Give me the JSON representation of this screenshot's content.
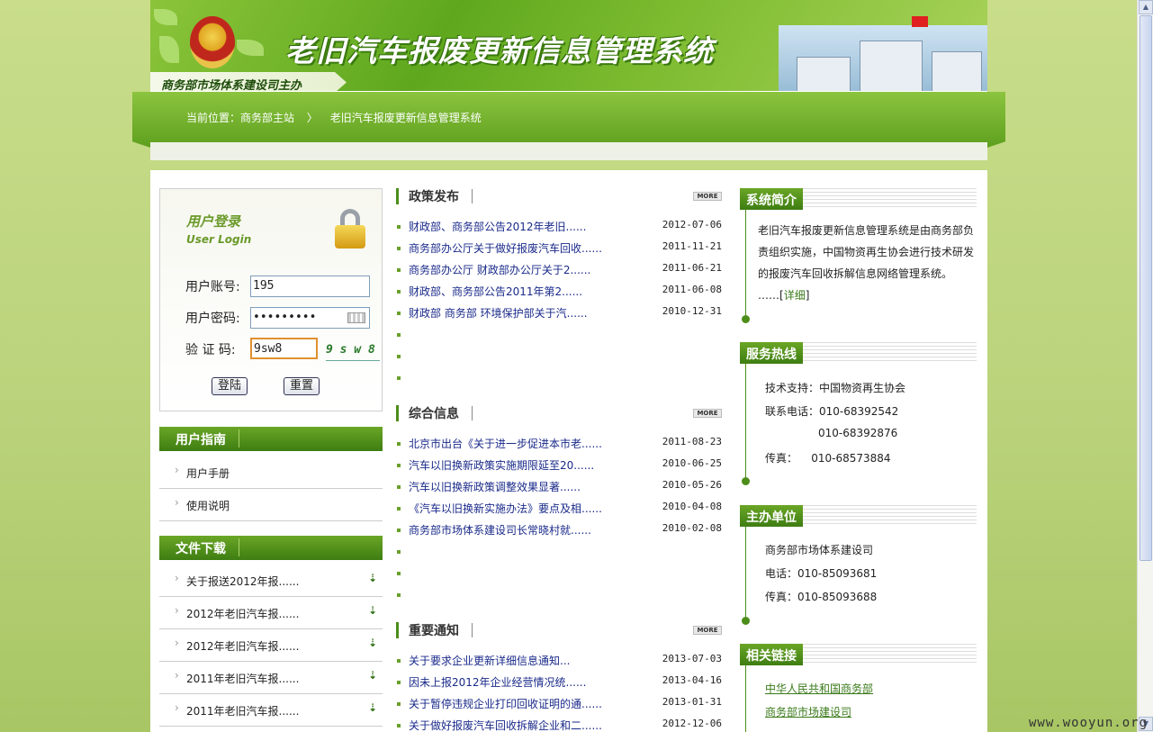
{
  "banner": {
    "title": "老旧汽车报废更新信息管理系统",
    "org": "商务部市场体系建设司主办"
  },
  "breadcrumb": {
    "label": "当前位置：商务部主站",
    "separator": "〉",
    "current": "老旧汽车报废更新信息管理系统"
  },
  "login": {
    "title_cn": "用户登录",
    "title_en": "User Login",
    "account_label": "用户账号:",
    "account_value": "195",
    "password_label": "用户密码:",
    "password_value": "•••••••••",
    "captcha_label": "验 证 码:",
    "captcha_value": "9sw8",
    "captcha_image": "9 s w 8",
    "login_button": "登陆",
    "reset_button": "重置"
  },
  "guide": {
    "title": "用户指南",
    "items": [
      "用户手册",
      "使用说明"
    ]
  },
  "downloads": {
    "title": "文件下载",
    "items": [
      "关于报送2012年报......",
      "2012年老旧汽车报......",
      "2012年老旧汽车报......",
      "2011年老旧汽车报......",
      "2011年老旧汽车报......"
    ]
  },
  "more_label": "MORE",
  "policy": {
    "title": "政策发布",
    "rows": [
      {
        "title": "财政部、商务部公告2012年老旧......",
        "date": "2012-07-06"
      },
      {
        "title": "商务部办公厅关于做好报废汽车回收......",
        "date": "2011-11-21"
      },
      {
        "title": "商务部办公厅 财政部办公厅关于2......",
        "date": "2011-06-21"
      },
      {
        "title": "财政部、商务部公告2011年第2......",
        "date": "2011-06-08"
      },
      {
        "title": "财政部 商务部 环境保护部关于汽......",
        "date": "2010-12-31"
      }
    ]
  },
  "general": {
    "title": "综合信息",
    "rows": [
      {
        "title": "北京市出台《关于进一步促进本市老......",
        "date": "2011-08-23"
      },
      {
        "title": "汽车以旧换新政策实施期限延至20......",
        "date": "2010-06-25"
      },
      {
        "title": "汽车以旧换新政策调整效果显著......",
        "date": "2010-05-26"
      },
      {
        "title": "《汽车以旧换新实施办法》要点及相......",
        "date": "2010-04-08"
      },
      {
        "title": "商务部市场体系建设司长常晓村就......",
        "date": "2010-02-08"
      }
    ]
  },
  "notices": {
    "title": "重要通知",
    "rows": [
      {
        "title": "关于要求企业更新详细信息通知...",
        "date": "2013-07-03"
      },
      {
        "title": "因未上报2012年企业经营情况统......",
        "date": "2013-04-16"
      },
      {
        "title": "关于暂停违规企业打印回收证明的通......",
        "date": "2013-01-31"
      },
      {
        "title": "关于做好报废汽车回收拆解企业和二......",
        "date": "2012-12-06"
      }
    ]
  },
  "intro": {
    "title": "系统简介",
    "text": "老旧汽车报废更新信息管理系统是由商务部负责组织实施，中国物资再生协会进行技术研发的报废汽车回收拆解信息网络管理系统。",
    "more_prefix": "……[",
    "more_link": "详细",
    "more_suffix": "]"
  },
  "hotline": {
    "title": "服务热线",
    "support": "技术支持：中国物资再生协会",
    "phone1": "联系电话：010-68392542",
    "phone2": "010-68392876",
    "fax": "传真：    010-68573884"
  },
  "host": {
    "title": "主办单位",
    "name": "商务部市场体系建设司",
    "phone": "电话：010-85093681",
    "fax": "传真：010-85093688"
  },
  "links": {
    "title": "相关链接",
    "items": [
      "中华人民共和国商务部",
      "商务部市场建设司"
    ]
  },
  "watermark": "www.wooyun.org"
}
